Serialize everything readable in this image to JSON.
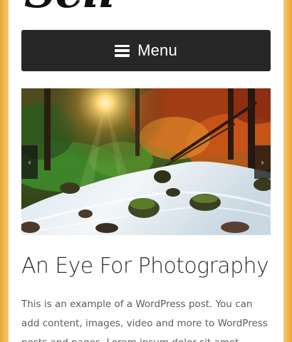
{
  "site": {
    "logo_text": "Sell"
  },
  "nav": {
    "menu_label": "Menu",
    "menu_icon": "hamburger-icon"
  },
  "slider": {
    "image_description": "forest stream with sunlight",
    "prev_glyph": "‹",
    "next_glyph": "›"
  },
  "post": {
    "title": "An Eye For Photography",
    "excerpt_line1": "This is an example of a WordPress post. You can",
    "excerpt_line2": "add content, images, video and more to WordPress",
    "excerpt_line3": "posts and pages. Lorem ipsum dolor sit amet,"
  },
  "colors": {
    "menu_bg": "#272727",
    "side_gradient": "#e9a534",
    "title": "#2d2d2d",
    "body_text": "#5c5c5c"
  }
}
